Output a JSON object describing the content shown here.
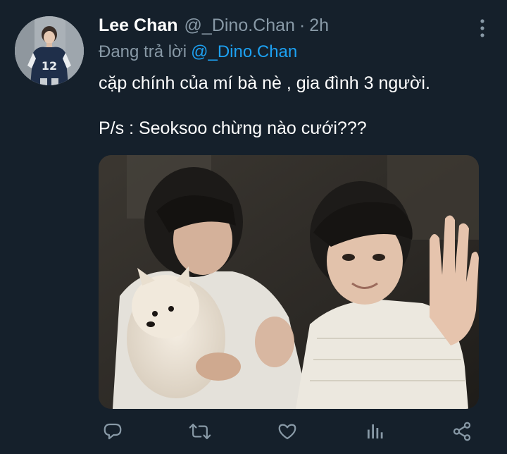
{
  "tweet": {
    "author_name": "Lee Chan",
    "author_handle": "@_Dino.Chan",
    "separator": "·",
    "time_ago": "2h",
    "reply_prefix": "Đang trả lời",
    "reply_to": "@_Dino.Chan",
    "text_line_1": "cặp chính của mí bà nè , gia đình 3 người.",
    "text_line_2": "P/s : Seoksoo chừng nào cưới???"
  },
  "avatar": {
    "jersey_number": "12"
  },
  "icons": {
    "more": "more-vertical-icon",
    "reply": "comment-bubble-icon",
    "retweet": "retweet-arrows-icon",
    "like": "heart-outline-icon",
    "analytics": "bar-chart-icon",
    "share": "share-nodes-icon"
  },
  "colors": {
    "background": "#15202b",
    "secondary_text": "#8899a6",
    "accent": "#1da1f2",
    "icon": "#8899a6"
  }
}
